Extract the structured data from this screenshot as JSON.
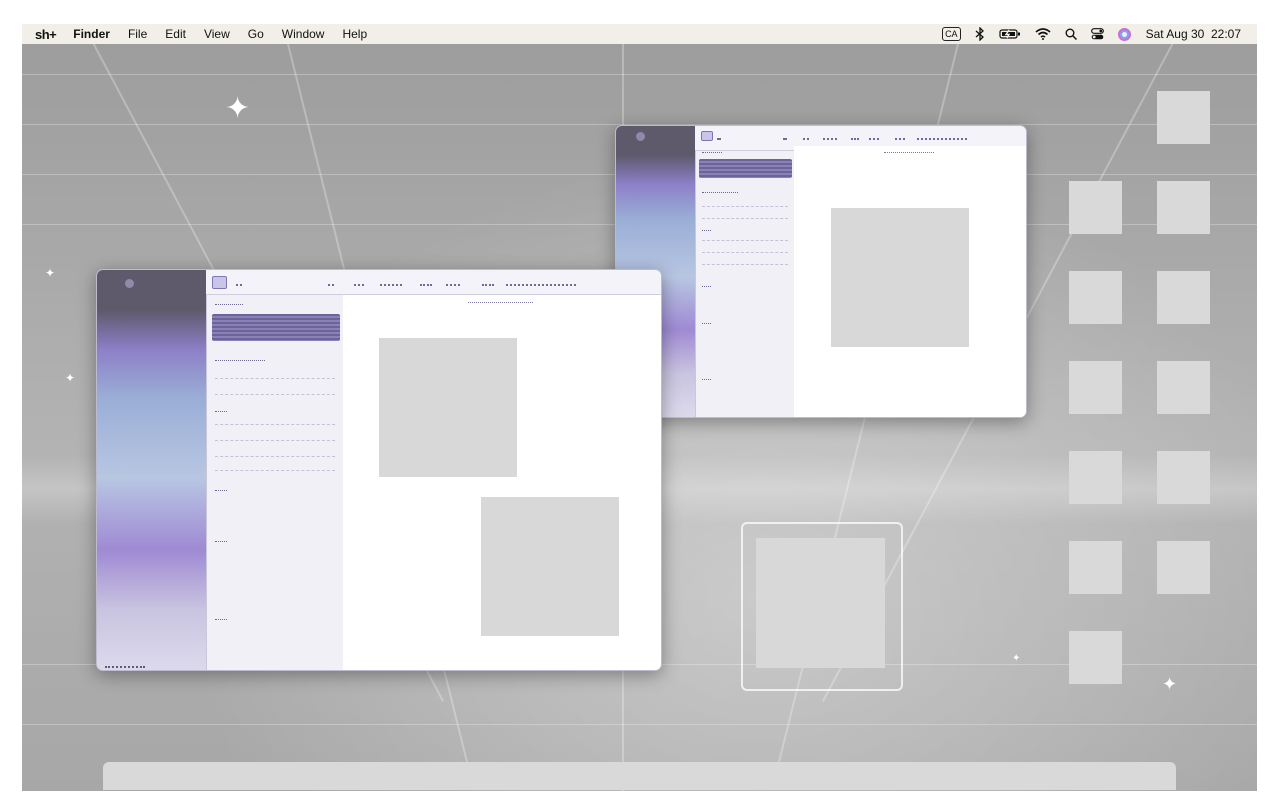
{
  "menubar": {
    "logo": "sh+",
    "app_name": "Finder",
    "menus": [
      "File",
      "Edit",
      "View",
      "Go",
      "Window",
      "Help"
    ],
    "status": {
      "input_source": "CA",
      "icons": [
        "bluetooth-icon",
        "battery-charging-icon",
        "wifi-icon",
        "search-icon",
        "control-center-icon",
        "siri-icon"
      ],
      "date": "Sat Aug 30",
      "time": "22:07"
    }
  },
  "desktop": {
    "icon_count": 13,
    "colors": {
      "icon_placeholder": "#d9d9d9",
      "menubar_bg": "#f2efe9",
      "window_accent": "#8d80c8"
    }
  },
  "windows": [
    {
      "name": "finder-window-back"
    },
    {
      "name": "finder-window-front"
    }
  ],
  "dock": {
    "visible": true
  }
}
